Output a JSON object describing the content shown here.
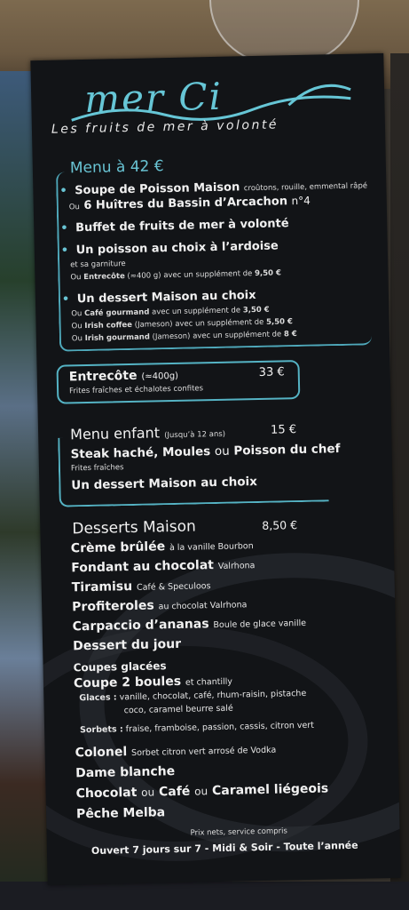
{
  "logo": {
    "text": "mer Ci",
    "tagline": "Les fruits de mer à volonté"
  },
  "menu42": {
    "title": "Menu à 42 €",
    "soupe": "Soupe de Poisson Maison",
    "soupe_sub": "croûtons, rouille, emmental râpé",
    "huitres_prefix": "Ou",
    "huitres": "6 Huîtres du Bassin d’Arcachon",
    "huitres_sub": "n°4",
    "buffet": "Buffet de fruits de mer à volonté",
    "poisson": "Un poisson au choix à l’ardoise",
    "garniture": "et sa garniture",
    "entrecote_supp_prefix": "Ou",
    "entrecote_supp_bold": "Entrecôte",
    "entrecote_supp_rest": "(≈400 g) avec un supplément de",
    "entrecote_supp_price": "9,50 €",
    "dessert": "Un dessert Maison au choix",
    "cafe_prefix": "Ou",
    "cafe_bold": "Café gourmand",
    "cafe_rest": "avec un supplément de",
    "cafe_price": "3,50 €",
    "irish_prefix": "Ou",
    "irish_bold": "Irish coffee",
    "irish_rest": "(Jameson) avec un supplément de",
    "irish_price": "5,50 €",
    "irishg_prefix": "Ou",
    "irishg_bold": "Irish gourmand",
    "irishg_rest": "(Jameson) avec un supplément de",
    "irishg_price": "8 €"
  },
  "entrecote": {
    "title": "Entrecôte",
    "weight": "(≈400g)",
    "price": "33 €",
    "sub": "Frites fraîches et échalotes confites"
  },
  "enfant": {
    "title": "Menu enfant",
    "age": "(Jusqu’à 12 ans)",
    "price": "15 €",
    "plat1": "Steak haché,",
    "plat2": "Moules",
    "ou1": "ou",
    "plat3": "Poisson du chef",
    "frites": "Frites fraîches",
    "dessert": "Un dessert Maison au choix"
  },
  "desserts": {
    "title": "Desserts Maison",
    "price": "8,50 €",
    "items": [
      {
        "name": "Crème brûlée",
        "sub": "à la vanille Bourbon"
      },
      {
        "name": "Fondant au chocolat",
        "sub": "Valrhona"
      },
      {
        "name": "Tiramisu",
        "sub": "Café & Speculoos"
      },
      {
        "name": "Profiteroles",
        "sub": "au chocolat Valrhona"
      },
      {
        "name": "Carpaccio d’ananas",
        "sub": "Boule de glace vanille"
      },
      {
        "name": "Dessert du jour",
        "sub": ""
      }
    ]
  },
  "coupes": {
    "title": "Coupes glacées",
    "coupe2": "Coupe 2 boules",
    "coupe2_sub": "et chantilly",
    "glaces_label": "Glaces :",
    "glaces_line1": "vanille, chocolat, café, rhum-raisin, pistache",
    "glaces_line2": "coco, caramel beurre salé",
    "sorbets_label": "Sorbets :",
    "sorbets": "fraise, framboise, passion, cassis, citron vert",
    "colonel": "Colonel",
    "colonel_sub": "Sorbet citron vert arrosé de Vodka",
    "dame": "Dame blanche",
    "liegeois1": "Chocolat",
    "ou1": "ou",
    "liegeois2": "Café",
    "ou2": "ou",
    "liegeois3": "Caramel liégeois",
    "peche": "Pêche Melba"
  },
  "footer": {
    "prix": "Prix nets, service compris",
    "horaires": "Ouvert 7 jours sur 7 - Midi & Soir - Toute l’année"
  }
}
